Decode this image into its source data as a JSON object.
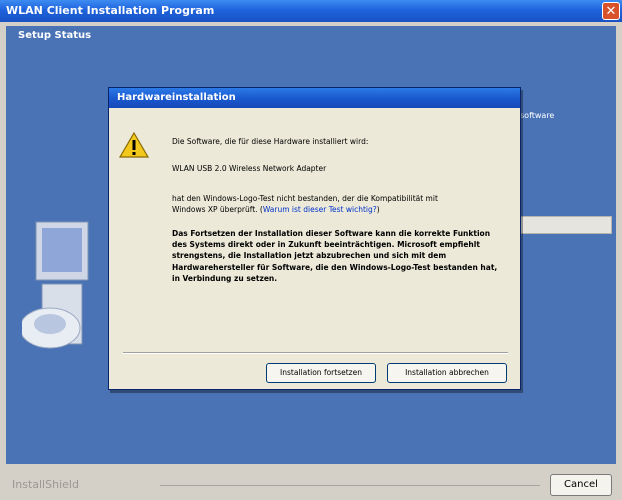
{
  "outer_window": {
    "title": "WLAN Client Installation Program",
    "close_glyph": "✕",
    "setup_status": "Setup Status",
    "background_fragment": "software",
    "brand": "InstallShield",
    "cancel_label": "Cancel"
  },
  "dialog": {
    "title": "Hardwareinstallation",
    "icon": "warning-icon",
    "software_line": "Die Software, die für diese Hardware installiert wird:",
    "device_name": "WLAN USB 2.0 Wireless Network Adapter",
    "logo_line1": "hat den Windows-Logo-Test nicht bestanden, der die Kompatibilität mit",
    "logo_line2": "Windows XP überprüft. (",
    "logo_link": "Warum ist dieser Test wichtig?",
    "logo_line2_end": ")",
    "warning_text": "Das Fortsetzen der Installation dieser Software kann die korrekte Funktion des Systems direkt oder in Zukunft beeinträchtigen. Microsoft empfiehlt strengstens, die Installation jetzt abzubrechen und sich mit dem Hardwarehersteller für Software, die den Windows-Logo-Test bestanden hat, in Verbindung zu setzen.",
    "continue_label": "Installation fortsetzen",
    "abort_label": "Installation abbrechen"
  },
  "colors": {
    "titlebar_blue": "#1f63dc",
    "installer_background": "#4a73b6",
    "dialog_background": "#ece9d8",
    "close_button_red": "#d9512b",
    "warning_yellow": "#f2c81c",
    "link_blue": "#0033cc"
  }
}
